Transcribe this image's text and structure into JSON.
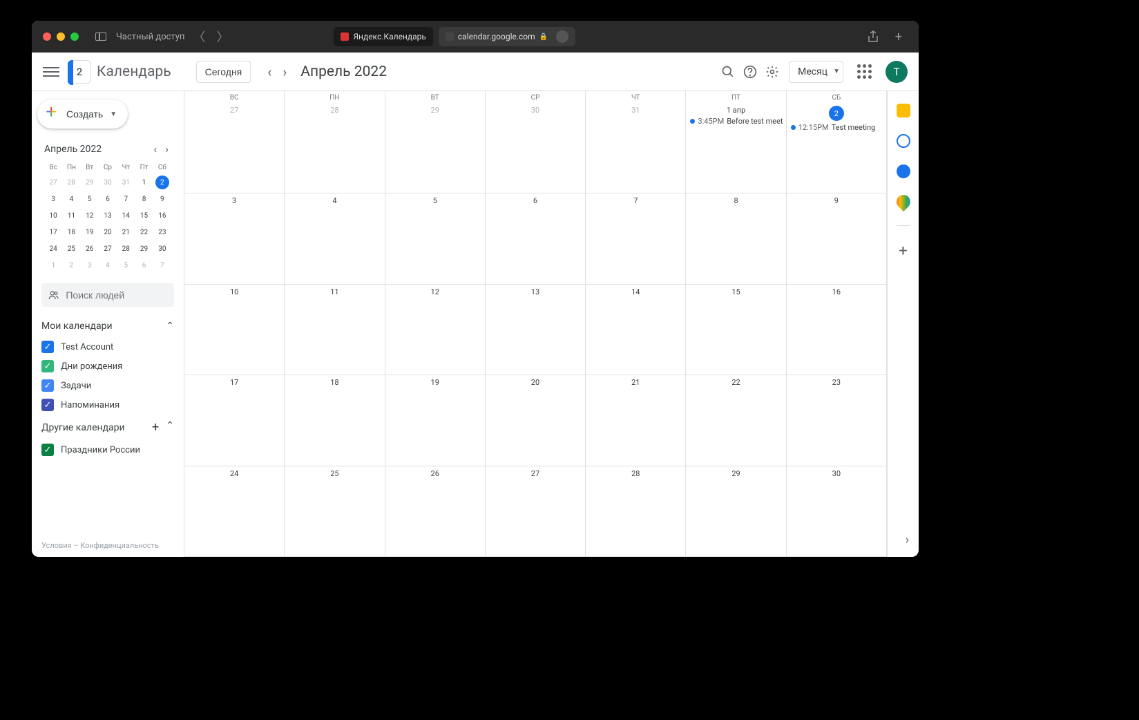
{
  "browser": {
    "private_label": "Частный доступ",
    "tabs": [
      {
        "title": "Яндекс.Календарь",
        "active": false
      },
      {
        "title": "calendar.google.com",
        "active": true
      }
    ]
  },
  "header": {
    "app_title": "Календарь",
    "logo_day": "2",
    "today_btn": "Сегодня",
    "period": "Апрель 2022",
    "view_label": "Месяц",
    "avatar_letter": "T"
  },
  "sidebar": {
    "create_label": "Создать",
    "mini_cal_title": "Апрель 2022",
    "dow": [
      "Вс",
      "Пн",
      "Вт",
      "Ср",
      "Чт",
      "Пт",
      "Сб"
    ],
    "mini_weeks": [
      [
        {
          "d": "27",
          "o": true
        },
        {
          "d": "28",
          "o": true
        },
        {
          "d": "29",
          "o": true
        },
        {
          "d": "30",
          "o": true
        },
        {
          "d": "31",
          "o": true
        },
        {
          "d": "1"
        },
        {
          "d": "2",
          "today": true
        }
      ],
      [
        {
          "d": "3"
        },
        {
          "d": "4"
        },
        {
          "d": "5"
        },
        {
          "d": "6"
        },
        {
          "d": "7"
        },
        {
          "d": "8"
        },
        {
          "d": "9"
        }
      ],
      [
        {
          "d": "10"
        },
        {
          "d": "11"
        },
        {
          "d": "12"
        },
        {
          "d": "13"
        },
        {
          "d": "14"
        },
        {
          "d": "15"
        },
        {
          "d": "16"
        }
      ],
      [
        {
          "d": "17"
        },
        {
          "d": "18"
        },
        {
          "d": "19"
        },
        {
          "d": "20"
        },
        {
          "d": "21"
        },
        {
          "d": "22"
        },
        {
          "d": "23"
        }
      ],
      [
        {
          "d": "24"
        },
        {
          "d": "25"
        },
        {
          "d": "26"
        },
        {
          "d": "27"
        },
        {
          "d": "28"
        },
        {
          "d": "29"
        },
        {
          "d": "30"
        }
      ],
      [
        {
          "d": "1",
          "o": true
        },
        {
          "d": "2",
          "o": true
        },
        {
          "d": "3",
          "o": true
        },
        {
          "d": "4",
          "o": true
        },
        {
          "d": "5",
          "o": true
        },
        {
          "d": "6",
          "o": true
        },
        {
          "d": "7",
          "o": true
        }
      ]
    ],
    "search_placeholder": "Поиск людей",
    "my_calendars_label": "Мои календари",
    "my_calendars": [
      {
        "label": "Test Account",
        "color": "#1a73e8"
      },
      {
        "label": "Дни рождения",
        "color": "#33b679"
      },
      {
        "label": "Задачи",
        "color": "#4285f4"
      },
      {
        "label": "Напоминания",
        "color": "#3f51b5"
      }
    ],
    "other_calendars_label": "Другие календари",
    "other_calendars": [
      {
        "label": "Праздники России",
        "color": "#0b8043"
      }
    ],
    "footer": "Условия – Конфиденциальность"
  },
  "grid": {
    "dow": [
      "ВС",
      "ПН",
      "ВТ",
      "СР",
      "ЧТ",
      "ПТ",
      "СБ"
    ],
    "weeks": [
      [
        {
          "d": "27",
          "o": true
        },
        {
          "d": "28",
          "o": true
        },
        {
          "d": "29",
          "o": true
        },
        {
          "d": "30",
          "o": true
        },
        {
          "d": "31",
          "o": true
        },
        {
          "d": "1 апр",
          "events": [
            {
              "time": "3:45PM",
              "title": "Before test meetin"
            }
          ]
        },
        {
          "d": "2",
          "today": true,
          "events": [
            {
              "time": "12:15PM",
              "title": "Test meeting"
            }
          ]
        }
      ],
      [
        {
          "d": "3"
        },
        {
          "d": "4"
        },
        {
          "d": "5"
        },
        {
          "d": "6"
        },
        {
          "d": "7"
        },
        {
          "d": "8"
        },
        {
          "d": "9"
        }
      ],
      [
        {
          "d": "10"
        },
        {
          "d": "11"
        },
        {
          "d": "12"
        },
        {
          "d": "13"
        },
        {
          "d": "14"
        },
        {
          "d": "15"
        },
        {
          "d": "16"
        }
      ],
      [
        {
          "d": "17"
        },
        {
          "d": "18"
        },
        {
          "d": "19"
        },
        {
          "d": "20"
        },
        {
          "d": "21"
        },
        {
          "d": "22"
        },
        {
          "d": "23"
        }
      ],
      [
        {
          "d": "24"
        },
        {
          "d": "25"
        },
        {
          "d": "26"
        },
        {
          "d": "27"
        },
        {
          "d": "28"
        },
        {
          "d": "29"
        },
        {
          "d": "30"
        }
      ]
    ]
  }
}
